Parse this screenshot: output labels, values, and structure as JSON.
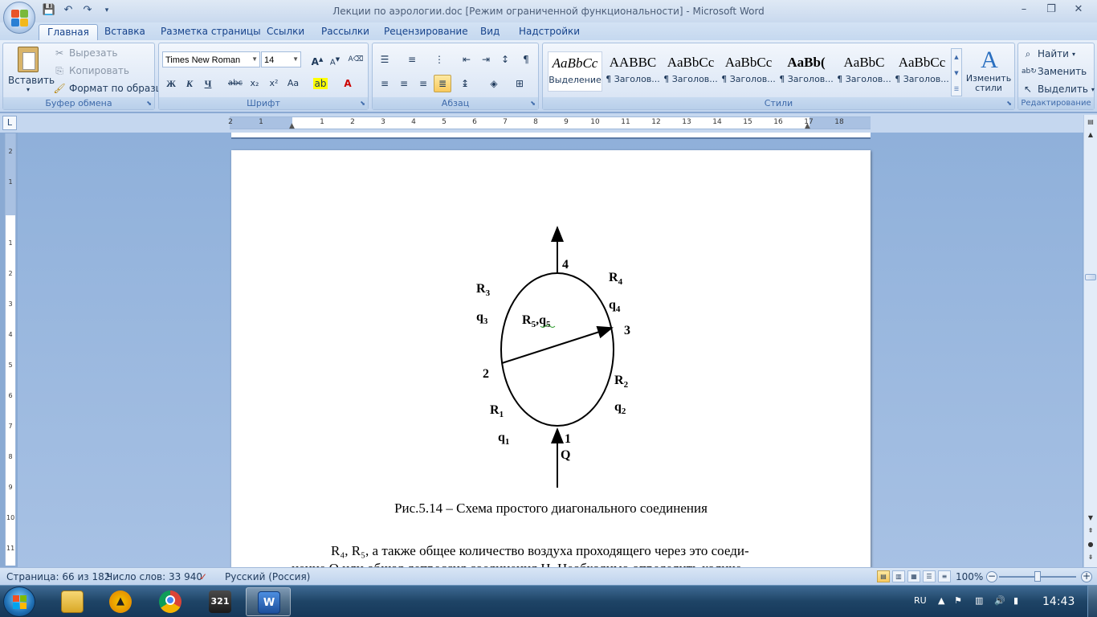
{
  "window": {
    "title": "Лекции по аэрологии.doc [Режим ограниченной функциональности] - Microsoft Word",
    "controls": [
      "–",
      "❐",
      "✕"
    ]
  },
  "qat": {
    "save_icon": "save-icon",
    "undo_icon": "undo-icon",
    "redo_icon": "redo-icon"
  },
  "tabs": [
    "Главная",
    "Вставка",
    "Разметка страницы",
    "Ссылки",
    "Рассылки",
    "Рецензирование",
    "Вид",
    "Надстройки"
  ],
  "ribbon": {
    "clipboard": {
      "label": "Буфер обмена",
      "paste": "Вставить",
      "cut": "Вырезать",
      "copy": "Копировать",
      "format_painter": "Формат по образцу"
    },
    "font": {
      "label": "Шрифт",
      "font_name": "Times New Roman",
      "font_size": "14",
      "bold": "Ж",
      "italic": "К",
      "underline": "Ч",
      "strike": "abc",
      "subscript": "x₂",
      "superscript": "x²",
      "case": "Aa"
    },
    "paragraph": {
      "label": "Абзац"
    },
    "styles": {
      "label": "Стили",
      "items": [
        {
          "sample": "AaBbCc",
          "name": "Выделение"
        },
        {
          "sample": "AABBC",
          "name": "¶ Заголов..."
        },
        {
          "sample": "AaBbCc",
          "name": "¶ Заголов..."
        },
        {
          "sample": "AaBbCc",
          "name": "¶ Заголов..."
        },
        {
          "sample": "AaBb(",
          "name": "¶ Заголов..."
        },
        {
          "sample": "AaBbC",
          "name": "¶ Заголов..."
        },
        {
          "sample": "AaBbCc",
          "name": "¶ Заголов..."
        }
      ],
      "change_styles": "Изменить стили"
    },
    "editing": {
      "label": "Редактирование",
      "find": "Найти",
      "replace": "Заменить",
      "select": "Выделить"
    }
  },
  "ruler": {
    "h_numbers": [
      "2",
      "1",
      "1",
      "2",
      "3",
      "4",
      "5",
      "6",
      "7",
      "8",
      "9",
      "10",
      "11",
      "12",
      "13",
      "14",
      "15",
      "16",
      "17",
      "18"
    ],
    "v_numbers": [
      "2",
      "1",
      "1",
      "2",
      "3",
      "4",
      "5",
      "6",
      "7",
      "8",
      "9",
      "10",
      "11"
    ]
  },
  "diagram": {
    "node_labels": [
      "1",
      "2",
      "3",
      "4"
    ],
    "inflow": "Q",
    "branches": [
      {
        "R": "R",
        "R_sub": "1",
        "q": "q",
        "q_sub": "1"
      },
      {
        "R": "R",
        "R_sub": "2",
        "q": "q",
        "q_sub": "2"
      },
      {
        "R": "R",
        "R_sub": "3",
        "q": "q",
        "q_sub": "3"
      },
      {
        "R": "R",
        "R_sub": "4",
        "q": "q",
        "q_sub": "4"
      }
    ],
    "diagonal": {
      "R": "R",
      "R_sub": "5",
      "sep": ",",
      "q": "q",
      "q_sub": "5"
    }
  },
  "document": {
    "caption": "Рис.5.14 – Схема простого диагонального соединения",
    "line1": "R₄, R₅, а также общее количество воздуха проходящего через это соеди-",
    "line2": "нение Q или общая депрессия соединения Н. Необходимо определить количе-"
  },
  "status": {
    "page": "Страница: 66 из 182",
    "words": "Число слов: 33 940",
    "language": "Русский (Россия)",
    "zoom": "100%",
    "zoom_level_percent": 100
  },
  "taskbar": {
    "lang": "RU",
    "time": "14:43",
    "apps": [
      "explorer-icon",
      "aimp-icon",
      "chrome-icon",
      "media-player-icon",
      "word-icon"
    ]
  }
}
